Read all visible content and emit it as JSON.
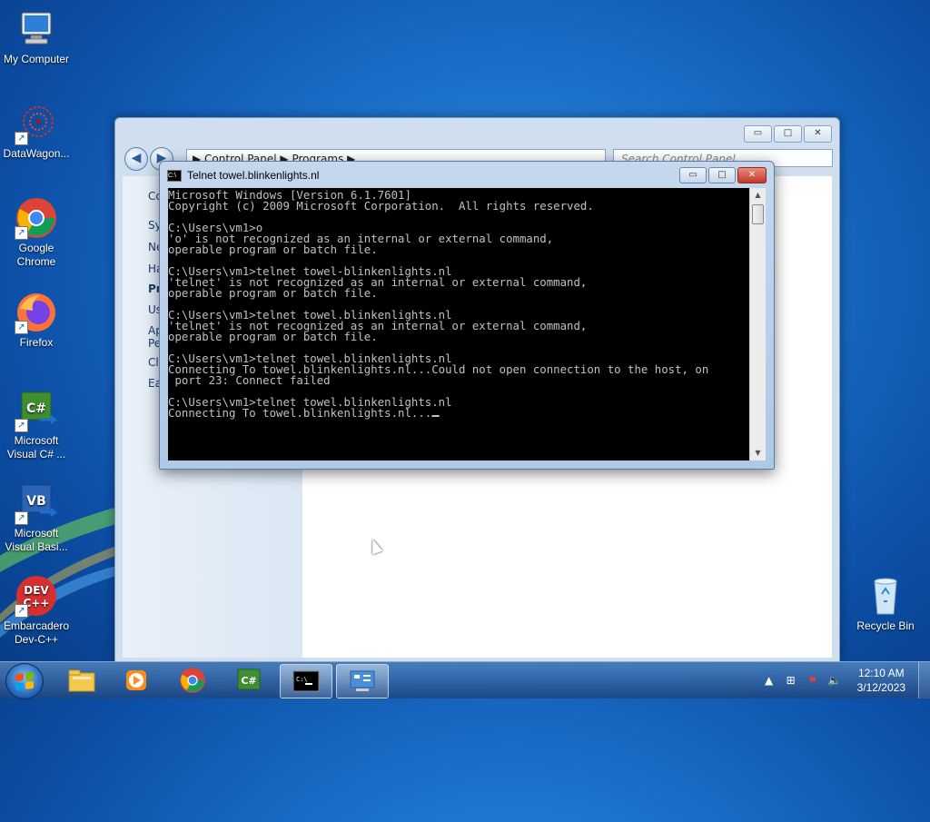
{
  "desktop": {
    "icons": [
      {
        "label": "My Computer",
        "icon": "computer-icon"
      },
      {
        "label": "DataWagon...",
        "icon": "datawagon-icon"
      },
      {
        "label": "Google Chrome",
        "icon": "chrome-icon"
      },
      {
        "label": "Firefox",
        "icon": "firefox-icon"
      },
      {
        "label": "Microsoft Visual C# ...",
        "icon": "visual-csharp-icon"
      },
      {
        "label": "Microsoft Visual Basi...",
        "icon": "visual-basic-icon"
      },
      {
        "label": "Embarcadero Dev-C++",
        "icon": "devcpp-icon"
      },
      {
        "label": "Recycle Bin",
        "icon": "recycle-bin-icon"
      }
    ]
  },
  "control_panel": {
    "address": "▶ Control Panel ▶ Programs ▶",
    "search_placeholder": "Search Control Panel",
    "left_links": [
      "Co",
      "Sy",
      "Ne",
      "Ha",
      "Pr",
      "Us",
      "Ap",
      "Pe",
      "Cl",
      "Ea"
    ]
  },
  "console_window": {
    "title": "Telnet towel.blinkenlights.nl",
    "lines": [
      "Microsoft Windows [Version 6.1.7601]",
      "Copyright (c) 2009 Microsoft Corporation.  All rights reserved.",
      "",
      "C:\\Users\\vm1>o",
      "'o' is not recognized as an internal or external command,",
      "operable program or batch file.",
      "",
      "C:\\Users\\vm1>telnet towel-blinkenlights.nl",
      "'telnet' is not recognized as an internal or external command,",
      "operable program or batch file.",
      "",
      "C:\\Users\\vm1>telnet towel.blinkenlights.nl",
      "'telnet' is not recognized as an internal or external command,",
      "operable program or batch file.",
      "",
      "C:\\Users\\vm1>telnet towel.blinkenlights.nl",
      "Connecting To towel.blinkenlights.nl...Could not open connection to the host, on",
      " port 23: Connect failed",
      "",
      "C:\\Users\\vm1>telnet towel.blinkenlights.nl",
      "Connecting To towel.blinkenlights.nl..."
    ],
    "buttons": {
      "minimize": "▭",
      "maximize": "□",
      "close": "✕"
    }
  },
  "taskbar": {
    "items": [
      {
        "name": "explorer",
        "icon": "folder-icon"
      },
      {
        "name": "media-player",
        "icon": "media-player-icon"
      },
      {
        "name": "chrome",
        "icon": "chrome-icon"
      },
      {
        "name": "visual-csharp",
        "icon": "visual-csharp-icon"
      },
      {
        "name": "cmd",
        "icon": "cmd-icon"
      },
      {
        "name": "control-panel",
        "icon": "control-panel-icon"
      }
    ],
    "clock_time": "12:10 AM",
    "clock_date": "3/12/2023"
  }
}
